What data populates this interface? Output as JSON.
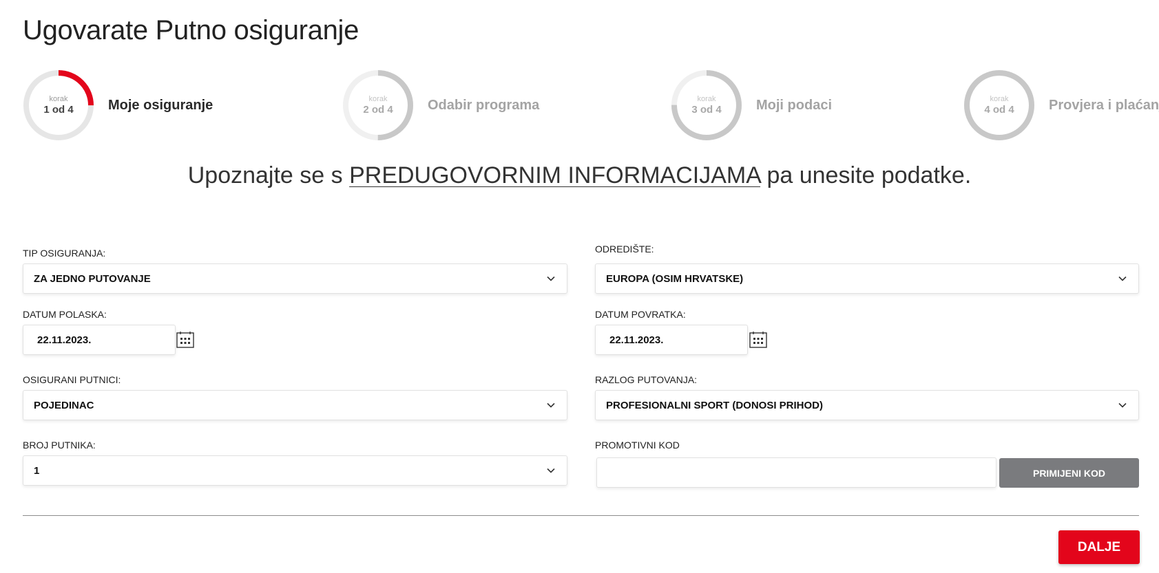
{
  "page_title": "Ugovarate Putno osiguranje",
  "steps": [
    {
      "korak": "korak",
      "count": "1 od 4",
      "label": "Moje osiguranje",
      "progress": 0.25,
      "active": true
    },
    {
      "korak": "korak",
      "count": "2 od 4",
      "label": "Odabir programa",
      "progress": 0.5,
      "active": false
    },
    {
      "korak": "korak",
      "count": "3 od 4",
      "label": "Moji podaci",
      "progress": 0.75,
      "active": false
    },
    {
      "korak": "korak",
      "count": "4 od 4",
      "label": "Provjera i plaćanje",
      "progress": 1.0,
      "active": false
    }
  ],
  "subtitle": {
    "before": "Upoznajte se s ",
    "link": "PREDUGOVORNIM INFORMACIJAMA",
    "after": " pa unesite podatke."
  },
  "form": {
    "tip_osiguranja": {
      "label": "TIP OSIGURANJA:",
      "value": "ZA JEDNO PUTOVANJE"
    },
    "odrediste": {
      "label": "ODREDIŠTE:",
      "value": "EUROPA (OSIM HRVATSKE)"
    },
    "datum_polaska": {
      "label": "DATUM POLASKA:",
      "value": "22.11.2023."
    },
    "datum_povratka": {
      "label": "DATUM POVRATKA:",
      "value": "22.11.2023."
    },
    "osigurani_putnici": {
      "label": "OSIGURANI PUTNICI:",
      "value": "POJEDINAC"
    },
    "razlog_putovanja": {
      "label": "RAZLOG PUTOVANJA:",
      "value": "PROFESIONALNI SPORT (DONOSI PRIHOD)"
    },
    "broj_putnika": {
      "label": "BROJ PUTNIKA:",
      "value": "1"
    },
    "promotivni_kod": {
      "label": "PROMOTIVNI KOD",
      "value": "",
      "button": "PRIMIJENI KOD"
    }
  },
  "next_button": "DALJE",
  "colors": {
    "accent": "#e3051b",
    "ring_track": "#e6e6e6",
    "ring_inactive": "#c8c8c8",
    "promo_button": "#7a7b7e"
  },
  "icons": {
    "chevron": "chevron-down-icon",
    "calendar": "calendar-icon"
  }
}
